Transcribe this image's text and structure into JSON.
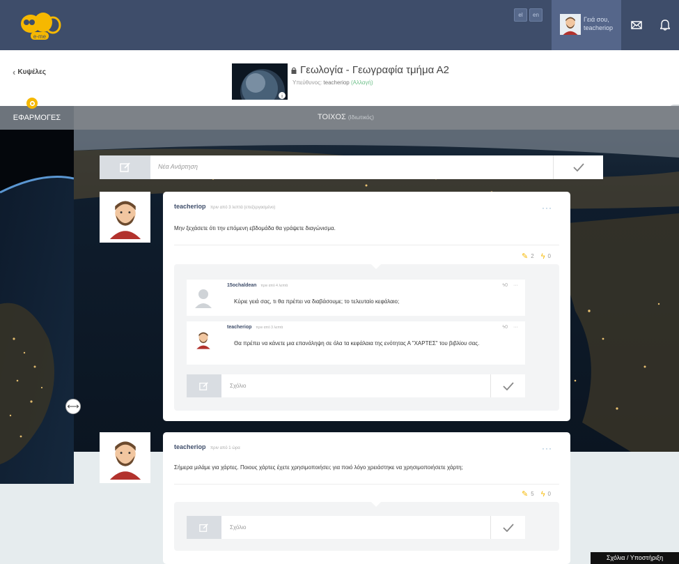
{
  "topbar": {
    "logo_text": "e-me",
    "languages": [
      "el",
      "en"
    ],
    "greeting": "Γειά σου,",
    "username": "teacheriop"
  },
  "subheader": {
    "back_label": "Κυψέλες",
    "group_title": "Γεωλογία - Γεωγραφία τμήμα Α2",
    "owner_label": "Υπεύθυνος:",
    "owner_name": "teacheriop",
    "change_label": "(Αλλαγή)"
  },
  "sidebar": {
    "apps_label": "ΕΦΑΡΜΟΓΕΣ"
  },
  "wall": {
    "title": "ΤΟΙΧΟΣ",
    "privacy": "(Ιδιωτικός)"
  },
  "new_post": {
    "placeholder": "Νέα Ανάρτηση"
  },
  "posts": [
    {
      "author": "teacheriop",
      "time": "πριν από 3 λεπτά (επεξεργασμένο)",
      "text": "Μην ξεχάσετε ότι την επόμενη εβδομάδα θα γράψετε διαγώνισμα.",
      "comment_count": "2",
      "likes": "0",
      "comments": [
        {
          "author": "15ochaldean",
          "time": "πριν από 4 λεπτά",
          "text": "Κύριε γειά σας, τι θα πρέπει να διαβάσουμε; το τελευταίο κεφάλαιο;",
          "likes": "0"
        },
        {
          "author": "teacheriop",
          "time": "πριν από 3 λεπτά",
          "text": "Θα πρέπει να κάνετε μια επανάληψη σε όλα τα κεφάλαια της ενότητας Α \"ΧΑΡΤΕΣ\" του βιβλίου σας.",
          "likes": "0"
        }
      ],
      "comment_placeholder": "Σχόλιο"
    },
    {
      "author": "teacheriop",
      "time": "πριν από 1 ώρα",
      "text": "Σήμερα μιλάμε για χάρτες. Ποιους χάρτες έχετε χρησιμοποιήσει; για ποιό λόγο χρειάστηκε να χρησιμοποιήσετε χάρτη;",
      "comment_count": "5",
      "likes": "0",
      "comment_placeholder": "Σχόλιο"
    }
  ],
  "footer": {
    "help_label": "Σχόλια / Υποστήριξη"
  },
  "colors": {
    "header": "#3e4d6a",
    "accent_yellow": "#f6b800",
    "link_green": "#6ec08a"
  }
}
